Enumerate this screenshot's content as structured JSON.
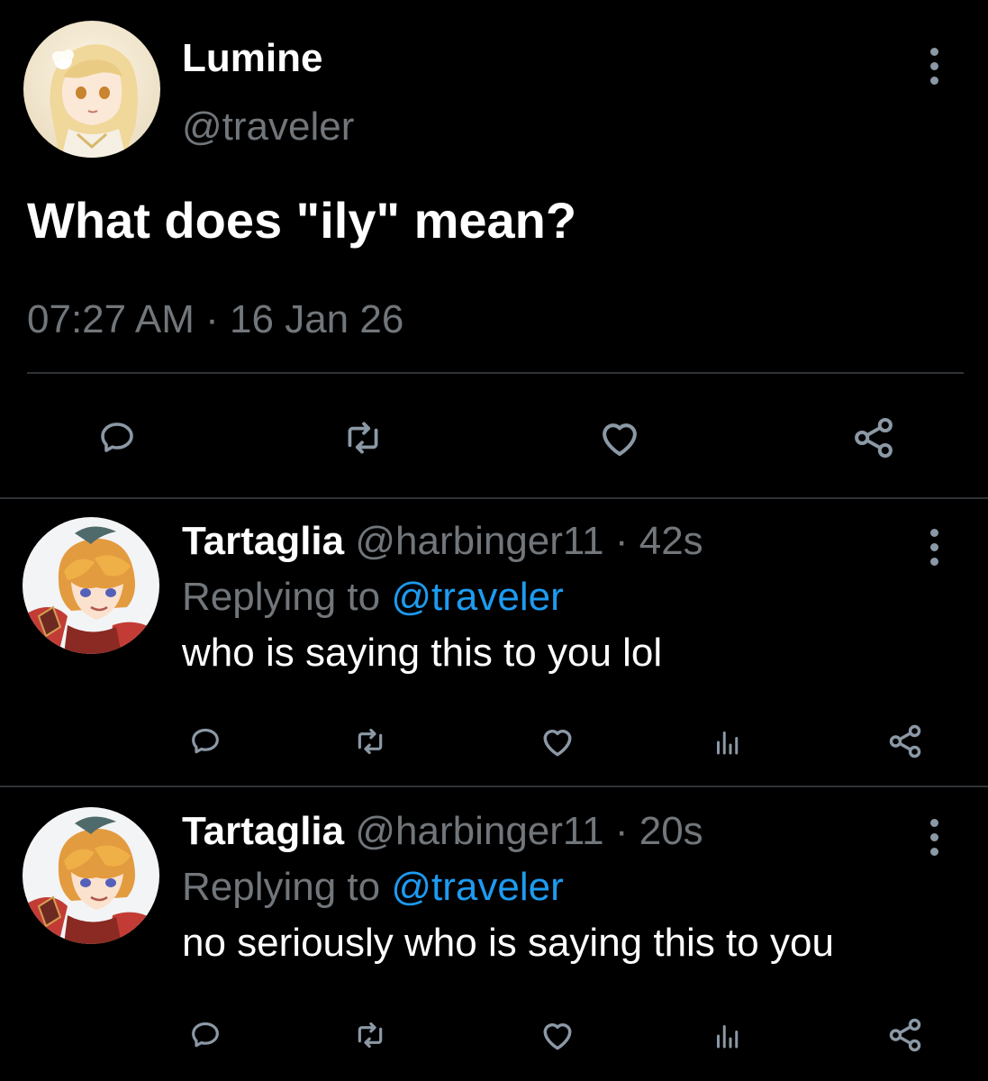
{
  "colors": {
    "background": "#000000",
    "primary_text": "#ffffff",
    "secondary_text": "#71767b",
    "mention": "#1d9bf0",
    "divider": "#2f3336"
  },
  "main_tweet": {
    "author_name": "Lumine",
    "author_handle": "@traveler",
    "text": "What does \"ily\" mean?",
    "time": "07:27 AM",
    "separator": "·",
    "date": "16 Jan 26",
    "avatar_icon": "lumine-avatar",
    "more_icon": "more-vertical-icon",
    "actions": [
      "reply-icon",
      "retweet-icon",
      "like-icon",
      "share-icon"
    ]
  },
  "replies": [
    {
      "name": "Tartaglia",
      "handle": "@harbinger11",
      "separator": "·",
      "age": "42s",
      "replying_prefix": "Replying to",
      "replying_to": "@traveler",
      "text": "who is saying this to you lol",
      "avatar_icon": "tartaglia-avatar",
      "more_icon": "more-vertical-icon",
      "actions": [
        "reply-icon",
        "retweet-icon",
        "like-icon",
        "analytics-icon",
        "share-icon"
      ]
    },
    {
      "name": "Tartaglia",
      "handle": "@harbinger11",
      "separator": "·",
      "age": "20s",
      "replying_prefix": "Replying to",
      "replying_to": "@traveler",
      "text": "no seriously who is saying this to you",
      "avatar_icon": "tartaglia-avatar",
      "more_icon": "more-vertical-icon",
      "actions": [
        "reply-icon",
        "retweet-icon",
        "like-icon",
        "analytics-icon",
        "share-icon"
      ]
    }
  ]
}
